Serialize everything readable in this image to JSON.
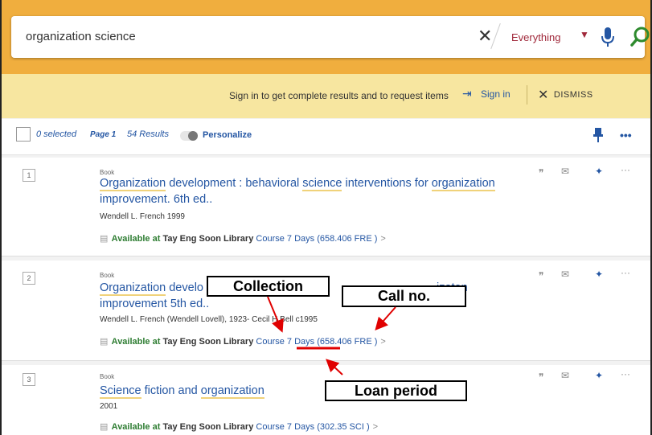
{
  "search": {
    "query": "organization science",
    "scope": "Everything"
  },
  "banner": {
    "message": "Sign in to get complete results and to request items",
    "signin": "Sign in",
    "dismiss": "DISMISS"
  },
  "toolbar": {
    "selected": "0 selected",
    "page": "Page 1",
    "results": "54 Results",
    "personalize": "Personalize"
  },
  "results": [
    {
      "num": "1",
      "type": "Book",
      "author": "Wendell L. French 1999",
      "available": "Available at",
      "library": "Tay Eng Soon Library",
      "location": "Course 7 Days (658.406 FRE )"
    },
    {
      "num": "2",
      "type": "Book",
      "author": "Wendell L. French (Wendell Lovell), 1923- Cecil H Bell c1995",
      "available": "Available at",
      "library": "Tay Eng Soon Library",
      "location": "Course 7 Days (658.406 FRE )"
    },
    {
      "num": "3",
      "type": "Book",
      "author": "2001",
      "available": "Available at",
      "library": "Tay Eng Soon Library",
      "location": "Course 7 Days (302.35 SCI )"
    }
  ],
  "annotations": {
    "collection": "Collection",
    "callno": "Call no.",
    "loan": "Loan period"
  },
  "colors": {
    "header": "#f0ae3e",
    "banner": "#f7e6a0",
    "link": "#2456a3",
    "available": "#2e7d32",
    "annotation_arrow": "#e00000"
  }
}
